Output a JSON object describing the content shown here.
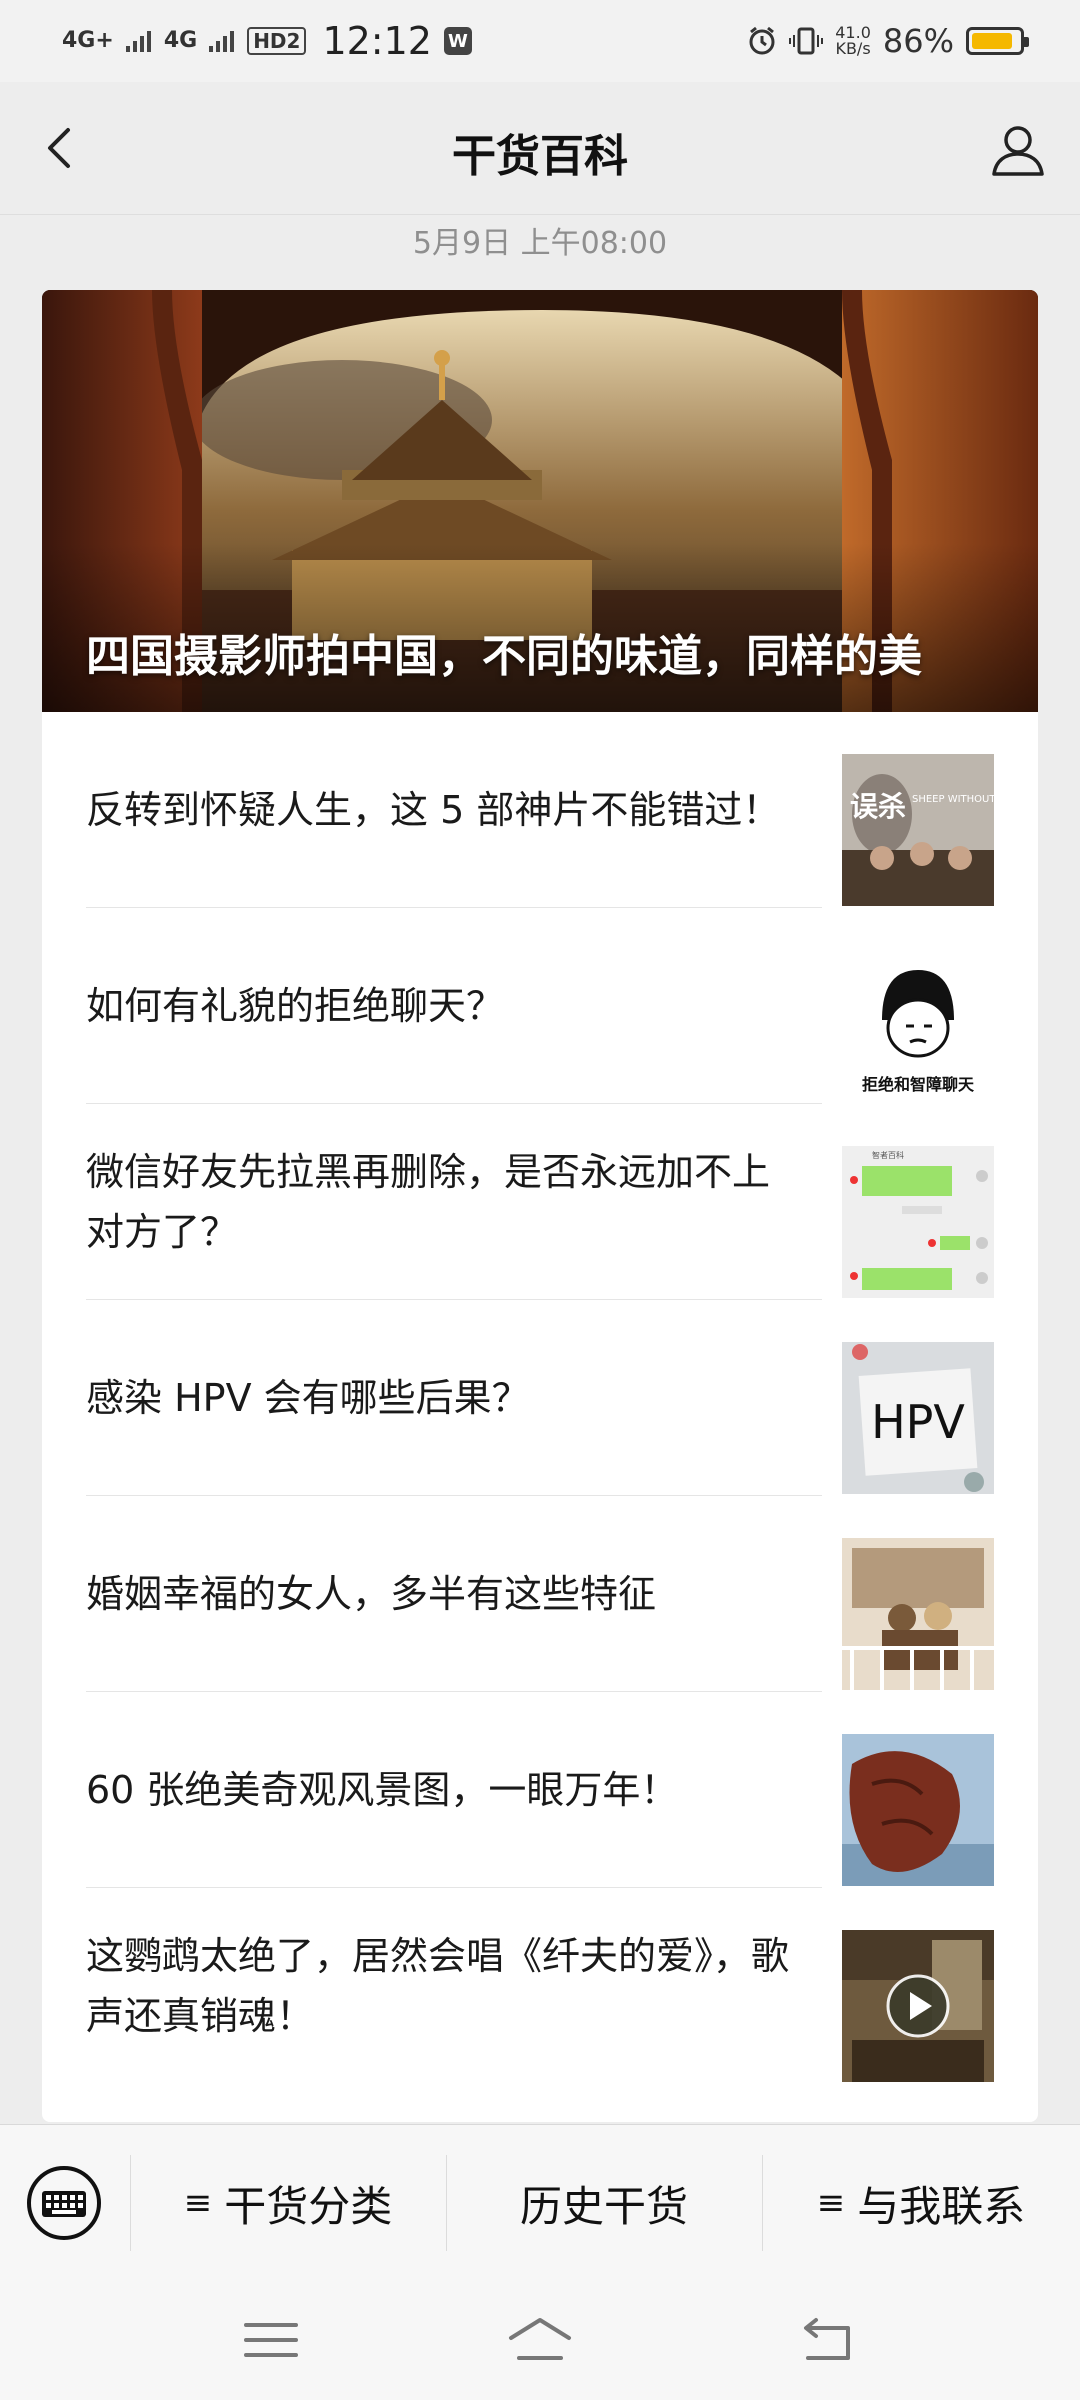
{
  "status_bar": {
    "net1": "4G+",
    "net2": "4G",
    "hd": "HD2",
    "time": "12:12",
    "app_badge": "W",
    "speed_value": "41.0",
    "speed_unit": "KB/s",
    "battery_pct": "86%",
    "battery_level": 0.86,
    "battery_color": "#f5b800"
  },
  "header": {
    "title": "干货百科",
    "back_icon": "chevron-left-icon",
    "profile_icon": "person-icon"
  },
  "timestamp": "5月9日 上午08:00",
  "hero": {
    "title": "四国摄影师拍中国，不同的味道，同样的美"
  },
  "articles": [
    {
      "title": "反转到怀疑人生，这 5 部神片不能错过！"
    },
    {
      "title": "如何有礼貌的拒绝聊天？",
      "thumb_caption": "拒绝和智障聊天"
    },
    {
      "title": "微信好友先拉黑再删除，是否永远加不上对方了？",
      "thumb_header": "智者百科"
    },
    {
      "title": "感染 HPV 会有哪些后果？",
      "thumb_caption": "HPV"
    },
    {
      "title": "婚姻幸福的女人，多半有这些特征"
    },
    {
      "title": "60 张绝美奇观风景图，一眼万年！"
    },
    {
      "title": "这鹦鹉太绝了，居然会唱《纤夫的爱》，歌声还真销魂！"
    }
  ],
  "bottom_menu": {
    "keyboard_icon": "keyboard-icon",
    "items": [
      {
        "label": "干货分类",
        "has_submenu": true
      },
      {
        "label": "历史干货",
        "has_submenu": false
      },
      {
        "label": "与我联系",
        "has_submenu": true
      }
    ]
  },
  "system_nav": {
    "menu_icon": "menu-icon",
    "home_icon": "home-icon",
    "back_icon": "back-icon"
  }
}
